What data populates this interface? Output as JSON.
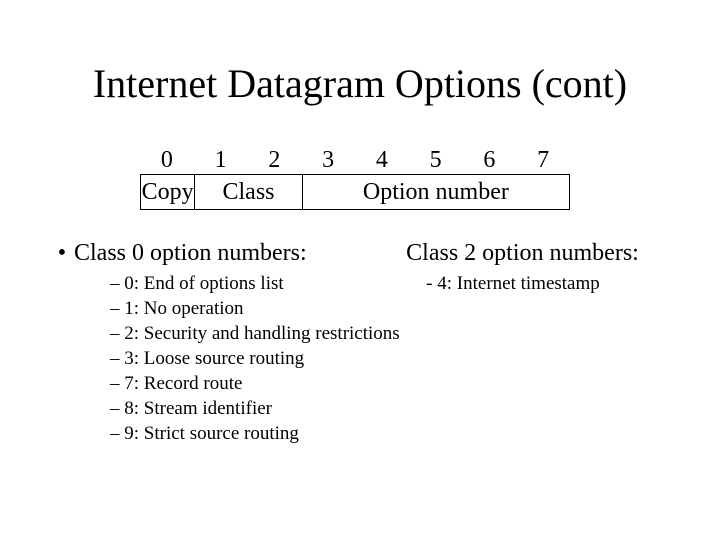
{
  "title": "Internet Datagram Options (cont)",
  "bits": [
    "0",
    "1",
    "2",
    "3",
    "4",
    "5",
    "6",
    "7"
  ],
  "fields": {
    "copy": "Copy",
    "class": "Class",
    "option": "Option number"
  },
  "class0": {
    "heading": "Class 0 option numbers:",
    "items": [
      "0: End of options list",
      "1: No operation",
      "2: Security and handling restrictions",
      "3: Loose source routing",
      "7: Record route",
      "8: Stream identifier",
      "9: Strict source routing"
    ]
  },
  "class2": {
    "heading": "Class 2 option numbers:",
    "items": [
      "- 4: Internet timestamp"
    ]
  },
  "bullet_char": "•"
}
